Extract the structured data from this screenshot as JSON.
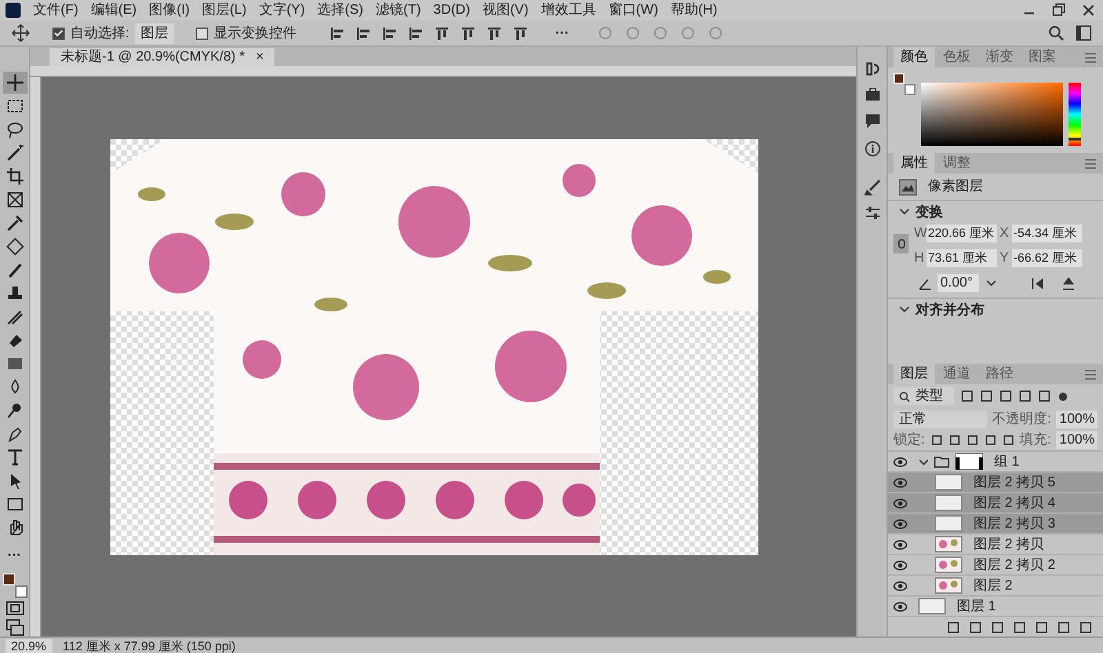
{
  "menu": [
    "文件(F)",
    "编辑(E)",
    "图像(I)",
    "图层(L)",
    "文字(Y)",
    "选择(S)",
    "滤镜(T)",
    "3D(D)",
    "视图(V)",
    "增效工具",
    "窗口(W)",
    "帮助(H)"
  ],
  "options": {
    "auto_select": {
      "label": "自动选择:",
      "checked": true,
      "value": "图层"
    },
    "show_transform": {
      "label": "显示变换控件",
      "checked": false
    },
    "more": "···"
  },
  "document_tab": {
    "title": "未标题-1 @ 20.9%(CMYK/8) *",
    "close": "×"
  },
  "tools": [
    {
      "selected": true
    },
    {
      "selected": false
    },
    {
      "selected": false
    },
    {
      "selected": false
    },
    {
      "selected": false
    },
    {
      "selected": false
    },
    {
      "selected": false
    },
    {
      "selected": false
    },
    {
      "selected": false
    },
    {
      "selected": false
    },
    {
      "selected": false
    },
    {
      "selected": false
    },
    {
      "selected": false
    },
    {
      "selected": false
    },
    {
      "selected": false
    },
    {
      "selected": false
    },
    {
      "selected": false
    },
    {
      "selected": false
    },
    {
      "selected": false
    },
    {
      "selected": false
    }
  ],
  "tool_more": "···",
  "color_panel": {
    "tabs": [
      {
        "label": "颜色",
        "selected": true
      },
      {
        "label": "色板",
        "selected": false
      },
      {
        "label": "渐变",
        "selected": false
      },
      {
        "label": "图案",
        "selected": false
      }
    ],
    "hue": {
      "level": 0.08
    }
  },
  "properties_panel": {
    "tabs": [
      {
        "label": "属性",
        "selected": true
      },
      {
        "label": "调整",
        "selected": false
      }
    ],
    "layer_type": "像素图层",
    "transform": {
      "title": "变换",
      "expanded": true,
      "w_label": "W",
      "w": "220.66 厘米",
      "x_label": "X",
      "x": "-54.34 厘米",
      "h_label": "H",
      "h": "73.61 厘米",
      "y_label": "Y",
      "y": "-66.62 厘米",
      "angle": "0.00°"
    },
    "align": {
      "title": "对齐并分布",
      "expanded": true
    }
  },
  "layers_panel": {
    "tabs": [
      {
        "label": "图层",
        "selected": true
      },
      {
        "label": "通道",
        "selected": false
      },
      {
        "label": "路径",
        "selected": false
      }
    ],
    "filter": "类型",
    "blend": "正常",
    "opacity_label": "不透明度:",
    "opacity": "100%",
    "lock_label": "锁定:",
    "fill_label": "填充:",
    "fill": "100%",
    "layers": [
      {
        "name": "组 1",
        "kind": "group",
        "expanded": true,
        "selected": false,
        "children": [
          {
            "name": "图层 2 拷贝 5",
            "kind": "layer",
            "selected": true
          },
          {
            "name": "图层 2 拷贝 4",
            "kind": "layer",
            "selected": true
          },
          {
            "name": "图层 2 拷贝 3",
            "kind": "layer",
            "selected": true
          },
          {
            "name": "图层 2 拷贝",
            "kind": "pattern",
            "selected": false
          },
          {
            "name": "图层 2 拷贝 2",
            "kind": "pattern",
            "selected": false
          },
          {
            "name": "图层 2",
            "kind": "pattern",
            "selected": false
          }
        ]
      },
      {
        "name": "图层 1",
        "kind": "layer",
        "selected": false
      }
    ]
  },
  "status_bar": {
    "zoom": "20.9%",
    "size": "112 厘米 x 77.99 厘米 (150 ppi)"
  }
}
